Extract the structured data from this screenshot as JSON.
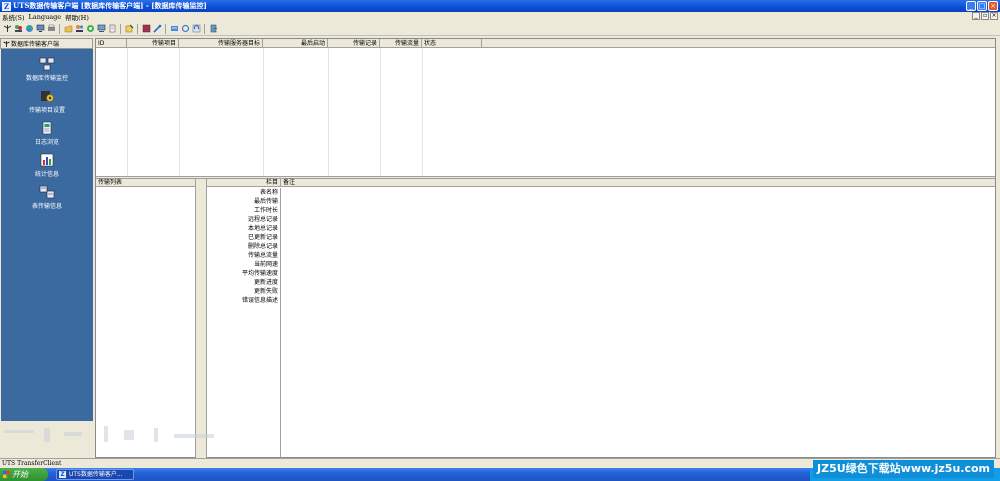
{
  "window": {
    "title": "UTS数据传输客户端 [数据库传输客户端] - [数据库传输监控]",
    "app_icon": "Z"
  },
  "menu": [
    "系统(S)",
    "Language",
    "帮助(H)"
  ],
  "sidebar": {
    "header": "数据库传输客户端",
    "items": [
      {
        "label": "数据库传输监控",
        "icon": "monitor-icon"
      },
      {
        "label": "传输项目设置",
        "icon": "settings-gear-icon"
      },
      {
        "label": "日志浏览",
        "icon": "log-icon"
      },
      {
        "label": "统计信息",
        "icon": "statistics-icon"
      },
      {
        "label": "表传输信息",
        "icon": "table-transfer-icon"
      }
    ]
  },
  "grid": {
    "columns": [
      "ID",
      "传输项目",
      "传输服务器目标",
      "最后启动",
      "传输记录",
      "传输流量",
      "状态"
    ]
  },
  "list_panel": {
    "header": "传输列表"
  },
  "detail_panel": {
    "header_col1": "栏目",
    "header_col2": "备注",
    "rows": [
      "表名称",
      "最后传输",
      "工作时长",
      "远程总记录",
      "本地总记录",
      "已更新记录",
      "删除总记录",
      "传输总流量",
      "当前网速",
      "平均传输速度",
      "更新进度",
      "更新失败",
      "错误信息描述"
    ]
  },
  "statusbar": {
    "text": "UTS TransferClient"
  },
  "taskbar": {
    "start_label": "开始",
    "task_label": "UTS数据传输客户..."
  },
  "watermark": {
    "text": "JZ5U绿色下载站www.jz5u.com"
  },
  "colors": {
    "sidebar_bg": "#3b6aa0",
    "titlebar": "#0a4fd6",
    "watermark": "#0f8fd8"
  }
}
